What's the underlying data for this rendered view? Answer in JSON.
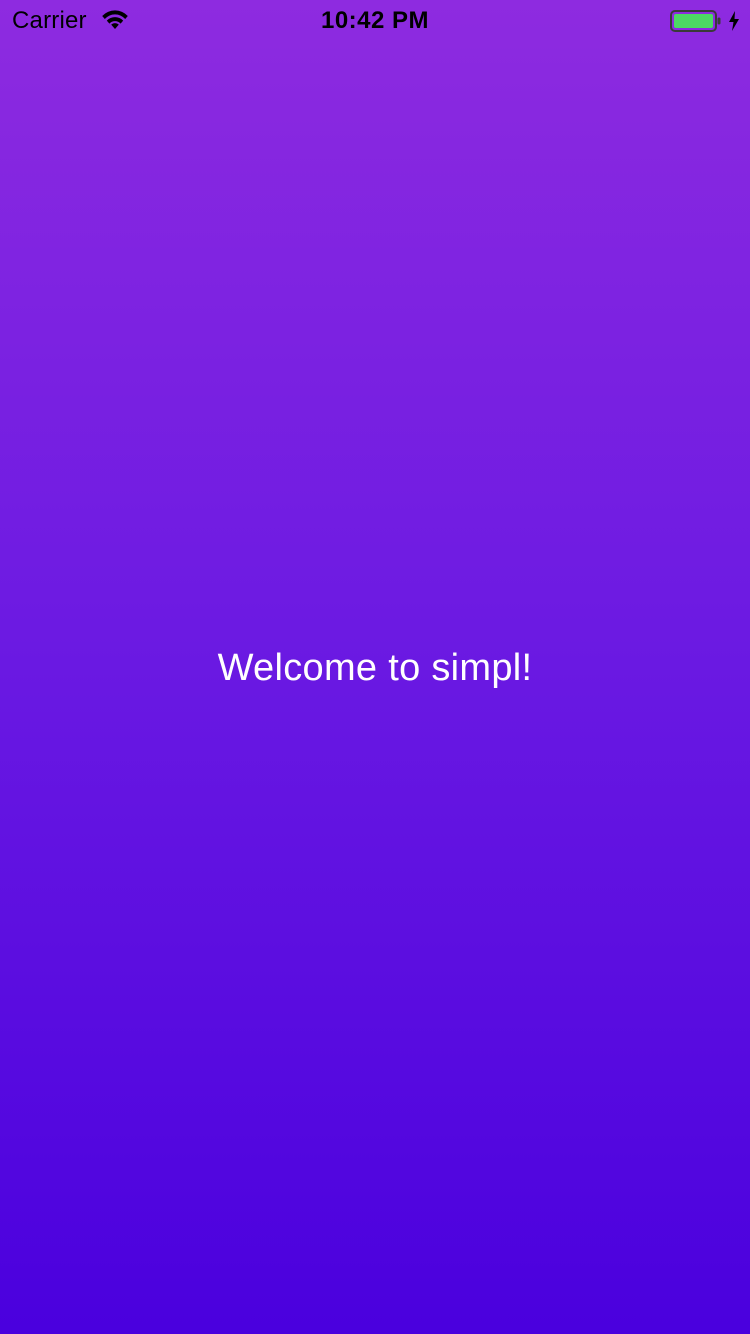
{
  "status_bar": {
    "carrier": "Carrier",
    "time": "10:42 PM",
    "wifi_icon": "wifi-icon",
    "battery_icon": "battery-icon",
    "charging_icon": "charging-bolt-icon",
    "battery_level": 1.0,
    "battery_color": "#4cd964"
  },
  "main": {
    "welcome_text": "Welcome to simpl!"
  },
  "colors": {
    "gradient_top": "#8e2be0",
    "gradient_bottom": "#4a00de",
    "text": "#ffffff"
  }
}
